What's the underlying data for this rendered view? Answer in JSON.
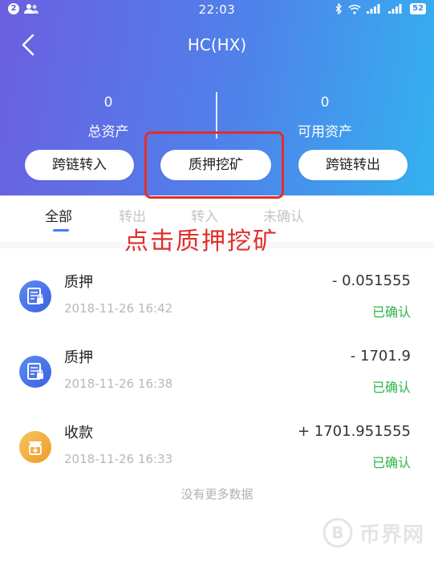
{
  "status_bar": {
    "notification_count": "2",
    "time": "22:03",
    "battery": "52"
  },
  "header": {
    "title": "HC(HX)",
    "total_assets": {
      "value": "0",
      "label": "总资产"
    },
    "available_assets": {
      "value": "0",
      "label": "可用资产"
    }
  },
  "actions": {
    "cross_chain_in": "跨链转入",
    "stake_mining": "质押挖矿",
    "cross_chain_out": "跨链转出"
  },
  "tabs": [
    {
      "label": "全部",
      "active": true
    },
    {
      "label": "转出",
      "active": false
    },
    {
      "label": "转入",
      "active": false
    },
    {
      "label": "未确认",
      "active": false
    }
  ],
  "annotation": "点击质押挖矿",
  "transactions": [
    {
      "type": "质押",
      "amount": "- 0.051555",
      "time": "2018-11-26 16:42",
      "status": "已确认",
      "icon": "stake-icon"
    },
    {
      "type": "质押",
      "amount": "- 1701.9",
      "time": "2018-11-26 16:38",
      "status": "已确认",
      "icon": "stake-icon"
    },
    {
      "type": "收款",
      "amount": "+ 1701.951555",
      "time": "2018-11-26 16:33",
      "status": "已确认",
      "icon": "receive-icon"
    }
  ],
  "no_more": "没有更多数据",
  "watermark": "币界网",
  "colors": {
    "accent": "#3d7ff0",
    "confirmed": "#2bb54a",
    "annotation": "#e02f2a"
  }
}
